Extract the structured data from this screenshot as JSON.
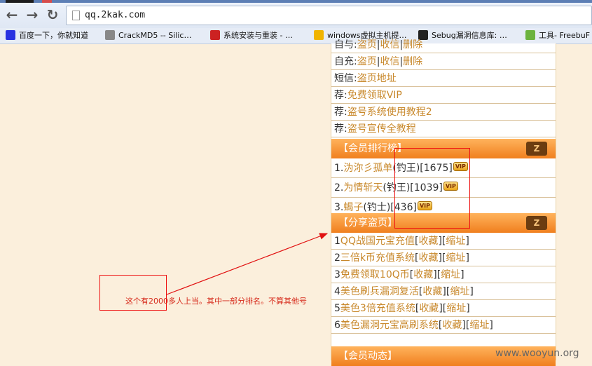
{
  "browser": {
    "url": "qq.2kak.com",
    "bookmarks": [
      {
        "label": "百度一下，你就知道",
        "icon": "baidu-icon",
        "color": "#2932e1"
      },
      {
        "label": "CrackMD5 -- Silic…",
        "icon": "page-icon",
        "color": "#888888"
      },
      {
        "label": "系统安装与重装 - …",
        "icon": "puzzle-icon",
        "color": "#cc2222"
      },
      {
        "label": "windows虚拟主机提…",
        "icon": "m-logo-icon",
        "color": "#f0b400"
      },
      {
        "label": "Sebug漏洞信息库: …",
        "icon": "s-logo-icon",
        "color": "#222222"
      },
      {
        "label": "工具- FreebuF",
        "icon": "f-logo-icon",
        "color": "#6cb33e"
      }
    ]
  },
  "panel": {
    "top_rows": [
      {
        "prefix": "自与:",
        "links": [
          "盗页",
          "收信",
          "删除"
        ]
      },
      {
        "prefix": "自充:",
        "links": [
          "盗页",
          "收信",
          "删除"
        ]
      },
      {
        "prefix": "短信:",
        "links": [
          "盗页地址"
        ]
      },
      {
        "prefix": "荐:",
        "links": [
          "免费领取VIP"
        ]
      },
      {
        "prefix": "荐:",
        "links": [
          "盗号系统使用教程2"
        ]
      },
      {
        "prefix": "荐:",
        "links": [
          "盗号宣传全教程"
        ]
      }
    ],
    "ranking": {
      "title": "【会员排行榜】",
      "more_label": "Z",
      "items": [
        {
          "num": "1.",
          "name": "沩沵彡孤单",
          "rank": "(钓王)",
          "score": "[1675]",
          "badge": "VIP"
        },
        {
          "num": "2.",
          "name": "为情斩天",
          "rank": "(钓王)",
          "score": "[1039]",
          "badge": "VIP"
        },
        {
          "num": "3.",
          "name": "蝎子",
          "rank": "(钓士)",
          "score": "[436]",
          "badge": "VIP"
        }
      ]
    },
    "share": {
      "title": "【分享盗页】",
      "more_label": "Z",
      "collect_label": "收藏",
      "shorten_label": "缩址",
      "items": [
        {
          "num": "1",
          "title": "QQ战国元宝充值"
        },
        {
          "num": "2",
          "title": "三倍k币充值系统"
        },
        {
          "num": "3",
          "title": "免费领取10Q币"
        },
        {
          "num": "4",
          "title": "美色刷兵漏洞复活"
        },
        {
          "num": "5",
          "title": "美色3倍充值系统"
        },
        {
          "num": "6",
          "title": "美色漏洞元宝高刷系统"
        }
      ]
    },
    "dynamic": {
      "title": "【会员动态】"
    }
  },
  "annotation": {
    "note": "这个有2000多人上当。其中一部分排名。不算其他号",
    "color": "#e11111"
  },
  "watermark": "www.wooyun.org"
}
